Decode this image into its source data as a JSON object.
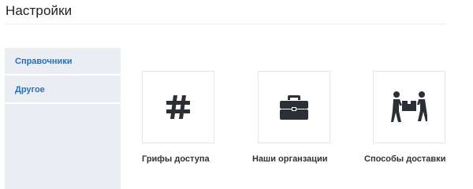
{
  "page": {
    "title": "Настройки"
  },
  "sidebar": {
    "items": [
      {
        "label": "Справочники"
      },
      {
        "label": "Другое"
      }
    ]
  },
  "tiles": [
    {
      "label": "Грифы доступа",
      "icon": "hash-icon"
    },
    {
      "label": "Наши органзации",
      "icon": "briefcase-icon"
    },
    {
      "label": "Способы доставки",
      "icon": "movers-carrying-box-icon"
    }
  ],
  "colors": {
    "accent": "#2a6fb5",
    "sidebar_bg": "#eaeef2",
    "icon": "#2b2f36"
  }
}
